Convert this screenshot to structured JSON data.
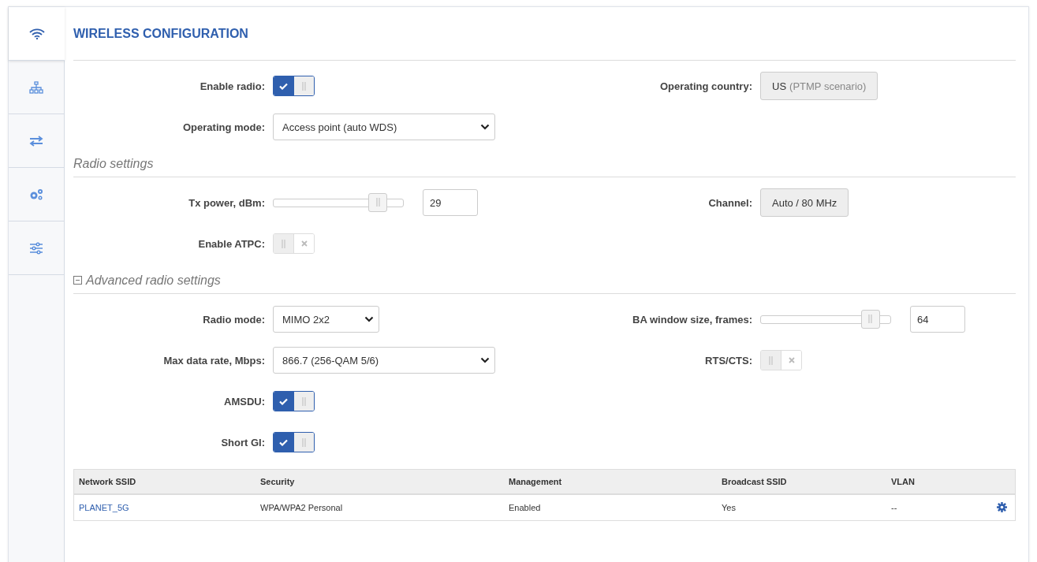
{
  "sidebar": {
    "items": [
      {
        "selected": true
      },
      {
        "selected": false
      },
      {
        "selected": false
      },
      {
        "selected": false
      },
      {
        "selected": false
      }
    ]
  },
  "title": "WIRELESS CONFIGURATION",
  "sections": [
    {
      "rows": [
        [
          {
            "label": "Enable radio:",
            "kind": "toggle",
            "on": true
          },
          {
            "label": "Operating country:",
            "kind": "button",
            "value": "US",
            "note": "(PTMP scenario)"
          }
        ],
        [
          {
            "label": "Operating mode:",
            "kind": "select",
            "value": "Access point (auto WDS)"
          }
        ]
      ]
    },
    {
      "title": "Radio settings",
      "rows": [
        [
          {
            "label": "Tx power, dBm:",
            "kind": "slider",
            "level": 0.88,
            "value": "29"
          },
          {
            "label": "Channel:",
            "kind": "button",
            "value": "Auto / 80 MHz"
          }
        ],
        [
          {
            "label": "Enable ATPC:",
            "kind": "toggle",
            "on": false
          }
        ]
      ]
    },
    {
      "title": "Advanced radio settings",
      "expanded": true,
      "rows": [
        [
          {
            "label": "Radio mode:",
            "kind": "select",
            "value": "MIMO 2x2"
          },
          {
            "label": "BA window size, frames:",
            "kind": "slider",
            "level": 0.92,
            "value": "64"
          }
        ],
        [
          {
            "label": "Max data rate, Mbps:",
            "kind": "select",
            "value": "866.7 (256-QAM 5/6)"
          },
          {
            "label": "RTS/CTS:",
            "kind": "toggle",
            "on": false
          }
        ],
        [
          {
            "label": "AMSDU:",
            "kind": "toggle",
            "on": true
          }
        ],
        [
          {
            "label": "Short GI:",
            "kind": "toggle",
            "on": true
          }
        ]
      ]
    }
  ],
  "table": {
    "columns": [
      "Network SSID",
      "Security",
      "Management",
      "Broadcast SSID",
      "VLAN"
    ],
    "rows": [
      {
        "cells": [
          "PLANET_5G",
          "WPA/WPA2 Personal",
          "Enabled",
          "Yes",
          "--"
        ]
      }
    ]
  }
}
